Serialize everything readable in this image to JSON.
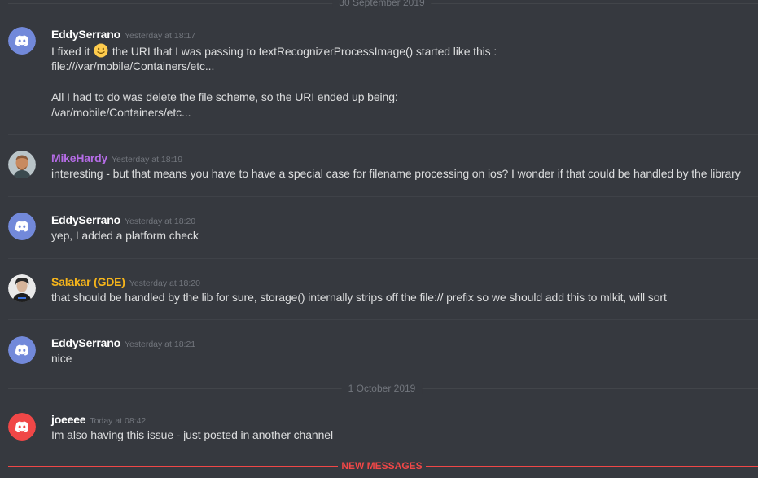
{
  "dividers": {
    "first": "30 September 2019",
    "second": "1 October 2019",
    "new_messages": "NEW MESSAGES"
  },
  "colors": {
    "background": "#36393f",
    "blurple": "#7289da",
    "red": "#f04747",
    "mikehardy": "#b56ce6",
    "salakar": "#f6b51b"
  },
  "messages": [
    {
      "username": "EddySerrano",
      "timestamp": "Yesterday at 18:17",
      "avatar": "discord-logo-blue",
      "lines": [
        "I fixed it",
        "the URI that I was passing to textRecognizerProcessImage() started like this :",
        "file:///var/mobile/Containers/etc...",
        "All I had to do was delete the file scheme, so the URI ended up being:",
        "/var/mobile/Containers/etc..."
      ],
      "emoji": "slightly-smiling-face-icon"
    },
    {
      "username": "MikeHardy",
      "timestamp": "Yesterday at 18:19",
      "avatar": "photo-avatar",
      "lines": [
        "interesting - but that means you have to have a special case for filename processing on ios? I wonder if that could be handled by the library"
      ]
    },
    {
      "username": "EddySerrano",
      "timestamp": "Yesterday at 18:20",
      "avatar": "discord-logo-blue",
      "lines": [
        "yep, I added a platform check"
      ]
    },
    {
      "username": "Salakar (GDE)",
      "timestamp": "Yesterday at 18:20",
      "avatar": "photo-avatar",
      "lines": [
        "that should be handled by the lib for sure, storage() internally strips off the file:// prefix so we should add this to mlkit, will sort"
      ]
    },
    {
      "username": "EddySerrano",
      "timestamp": "Yesterday at 18:21",
      "avatar": "discord-logo-blue",
      "lines": [
        "nice"
      ]
    },
    {
      "username": "joeeee",
      "timestamp": "Today at 08:42",
      "avatar": "discord-logo-red",
      "lines": [
        "Im also having this issue - just posted in another channel"
      ]
    }
  ]
}
